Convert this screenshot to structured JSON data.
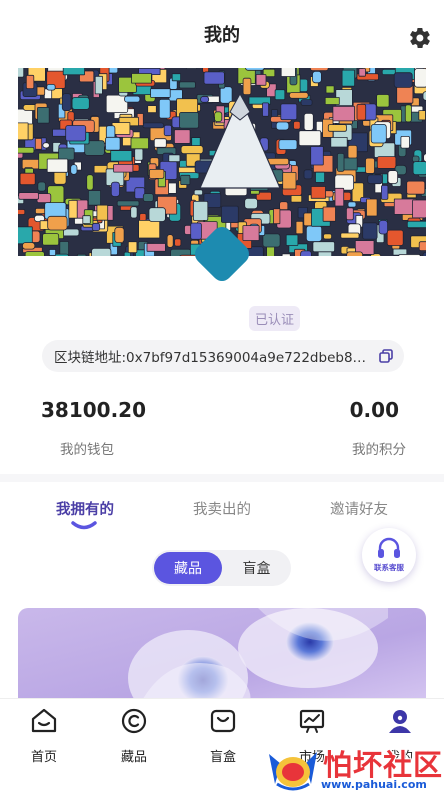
{
  "header": {
    "title": "我的",
    "settings_icon": "gear-icon"
  },
  "profile": {
    "verified_label": "已认证",
    "chain_address": "区块链地址:0x7bf97d15369004a9e722dbeb88c...",
    "copy_icon": "copy-icon"
  },
  "stats": {
    "wallet_value": "38100.20",
    "wallet_label": "我的钱包",
    "points_value": "0.00",
    "points_label": "我的积分"
  },
  "tabs": [
    {
      "label": "我拥有的",
      "active": true
    },
    {
      "label": "我卖出的",
      "active": false
    },
    {
      "label": "邀请好友",
      "active": false
    }
  ],
  "segment": {
    "options": [
      "藏品",
      "盲盒"
    ],
    "selected": "藏品"
  },
  "service": {
    "label": "联系客服",
    "icon": "headset-icon"
  },
  "bottom_nav": [
    {
      "label": "首页",
      "icon": "home-icon"
    },
    {
      "label": "藏品",
      "icon": "copyright-icon"
    },
    {
      "label": "盲盒",
      "icon": "bag-icon"
    },
    {
      "label": "市场",
      "icon": "trend-chart-icon"
    },
    {
      "label": "我的",
      "icon": "user-icon",
      "active": true
    }
  ],
  "watermark": {
    "name": "怕坏社区",
    "url": "www.pahuai.com"
  },
  "colors": {
    "accent": "#5b55e0",
    "active_tab": "#4b3fa6",
    "avatar": "#1d8bb0"
  }
}
